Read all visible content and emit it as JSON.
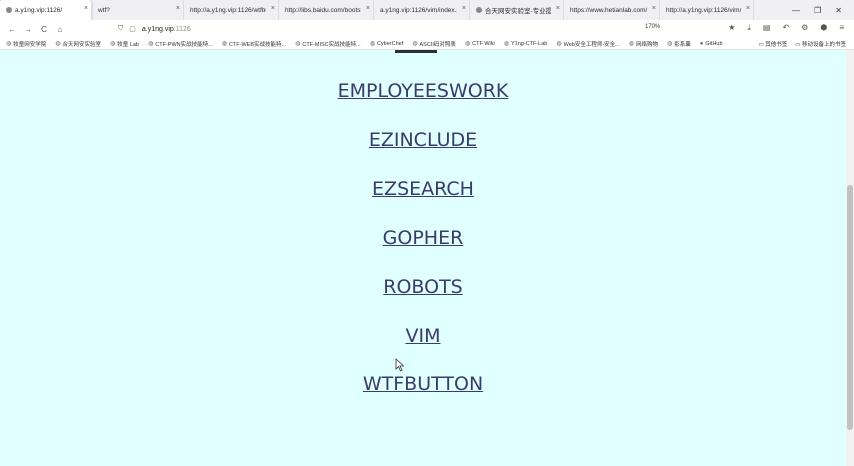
{
  "tabs": [
    {
      "label": "a.y1ng.vip:1126/",
      "active": true
    },
    {
      "label": "wtf?",
      "active": false
    },
    {
      "label": "http://a.y1ng.vip:1126/wtfbutton",
      "active": false
    },
    {
      "label": "http://libs.baidu.com/bootstrap",
      "active": false
    },
    {
      "label": "a.y1ng.vip:1126/vim/index.php",
      "active": false
    },
    {
      "label": "合天网安实验室-专业提供网络",
      "active": false
    },
    {
      "label": "https://www.hetianlab.com/",
      "active": false
    },
    {
      "label": "http://a.y1ng.vip:1126/vim/",
      "active": false
    }
  ],
  "window_controls": [
    "—",
    "❐",
    "✕"
  ],
  "nav": {
    "back": "←",
    "forward": "→",
    "reload": "C",
    "home": "⌂",
    "url_host": "a.y1ng.vip",
    "url_port": ":1126",
    "zoom": "170%"
  },
  "bookmarks": [
    "牧童网安学院",
    "合天网安实验室",
    "牧童 Lab",
    "CTF-PWN实战技能特...",
    "CTF-WEB实战技能特...",
    "CTF-MISC实战技能特...",
    "CyberChef",
    "ASCII码对照表",
    "CTF Wiki",
    "Y1ng-CTF-Lab",
    "Web安全工程师-安全...",
    "网络购物",
    "影系囊",
    "GitHub"
  ],
  "bookmarks_right": [
    "其他书签",
    "移动设备上的书签"
  ],
  "links": [
    "EMPLOYEESWORK",
    "EZINCLUDE",
    "EZSEARCH",
    "GOPHER",
    "ROBOTS",
    "VIM",
    "WTFBUTTON"
  ]
}
